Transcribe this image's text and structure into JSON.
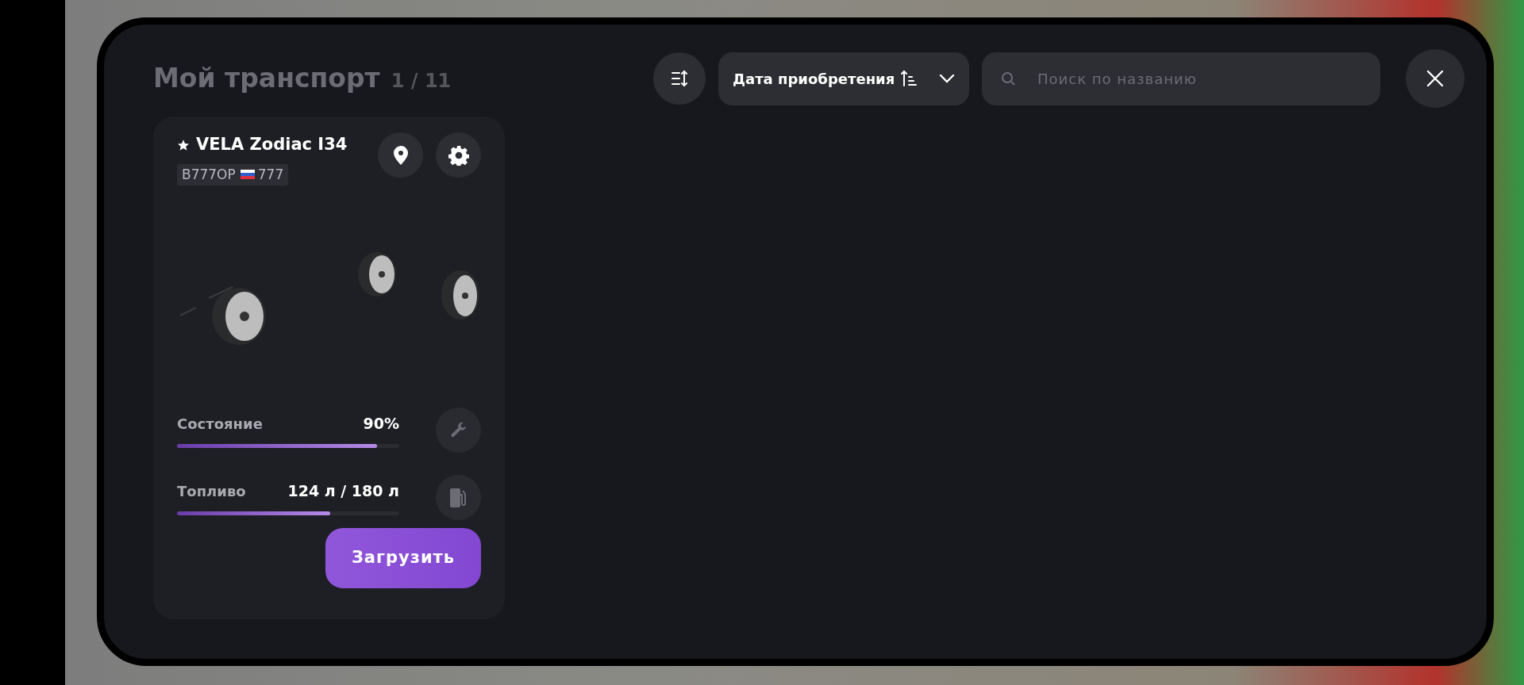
{
  "header": {
    "title": "Мой транспорт",
    "counter": "1 / 11"
  },
  "sort": {
    "label": "Дата приобретения"
  },
  "search": {
    "placeholder": "Поиск по названию"
  },
  "vehicles": [
    {
      "name": "VELA Zodiac I34",
      "favorite": true,
      "plate": "B777OP",
      "region": "777",
      "stats": [
        {
          "kind": "repair",
          "label": "Состояние",
          "value": "90%",
          "level": 0.9
        },
        {
          "kind": "fuel",
          "label": "Топливо",
          "value": "124 л / 180 л",
          "level": 0.69
        }
      ],
      "action": "Загрузить"
    }
  ]
}
